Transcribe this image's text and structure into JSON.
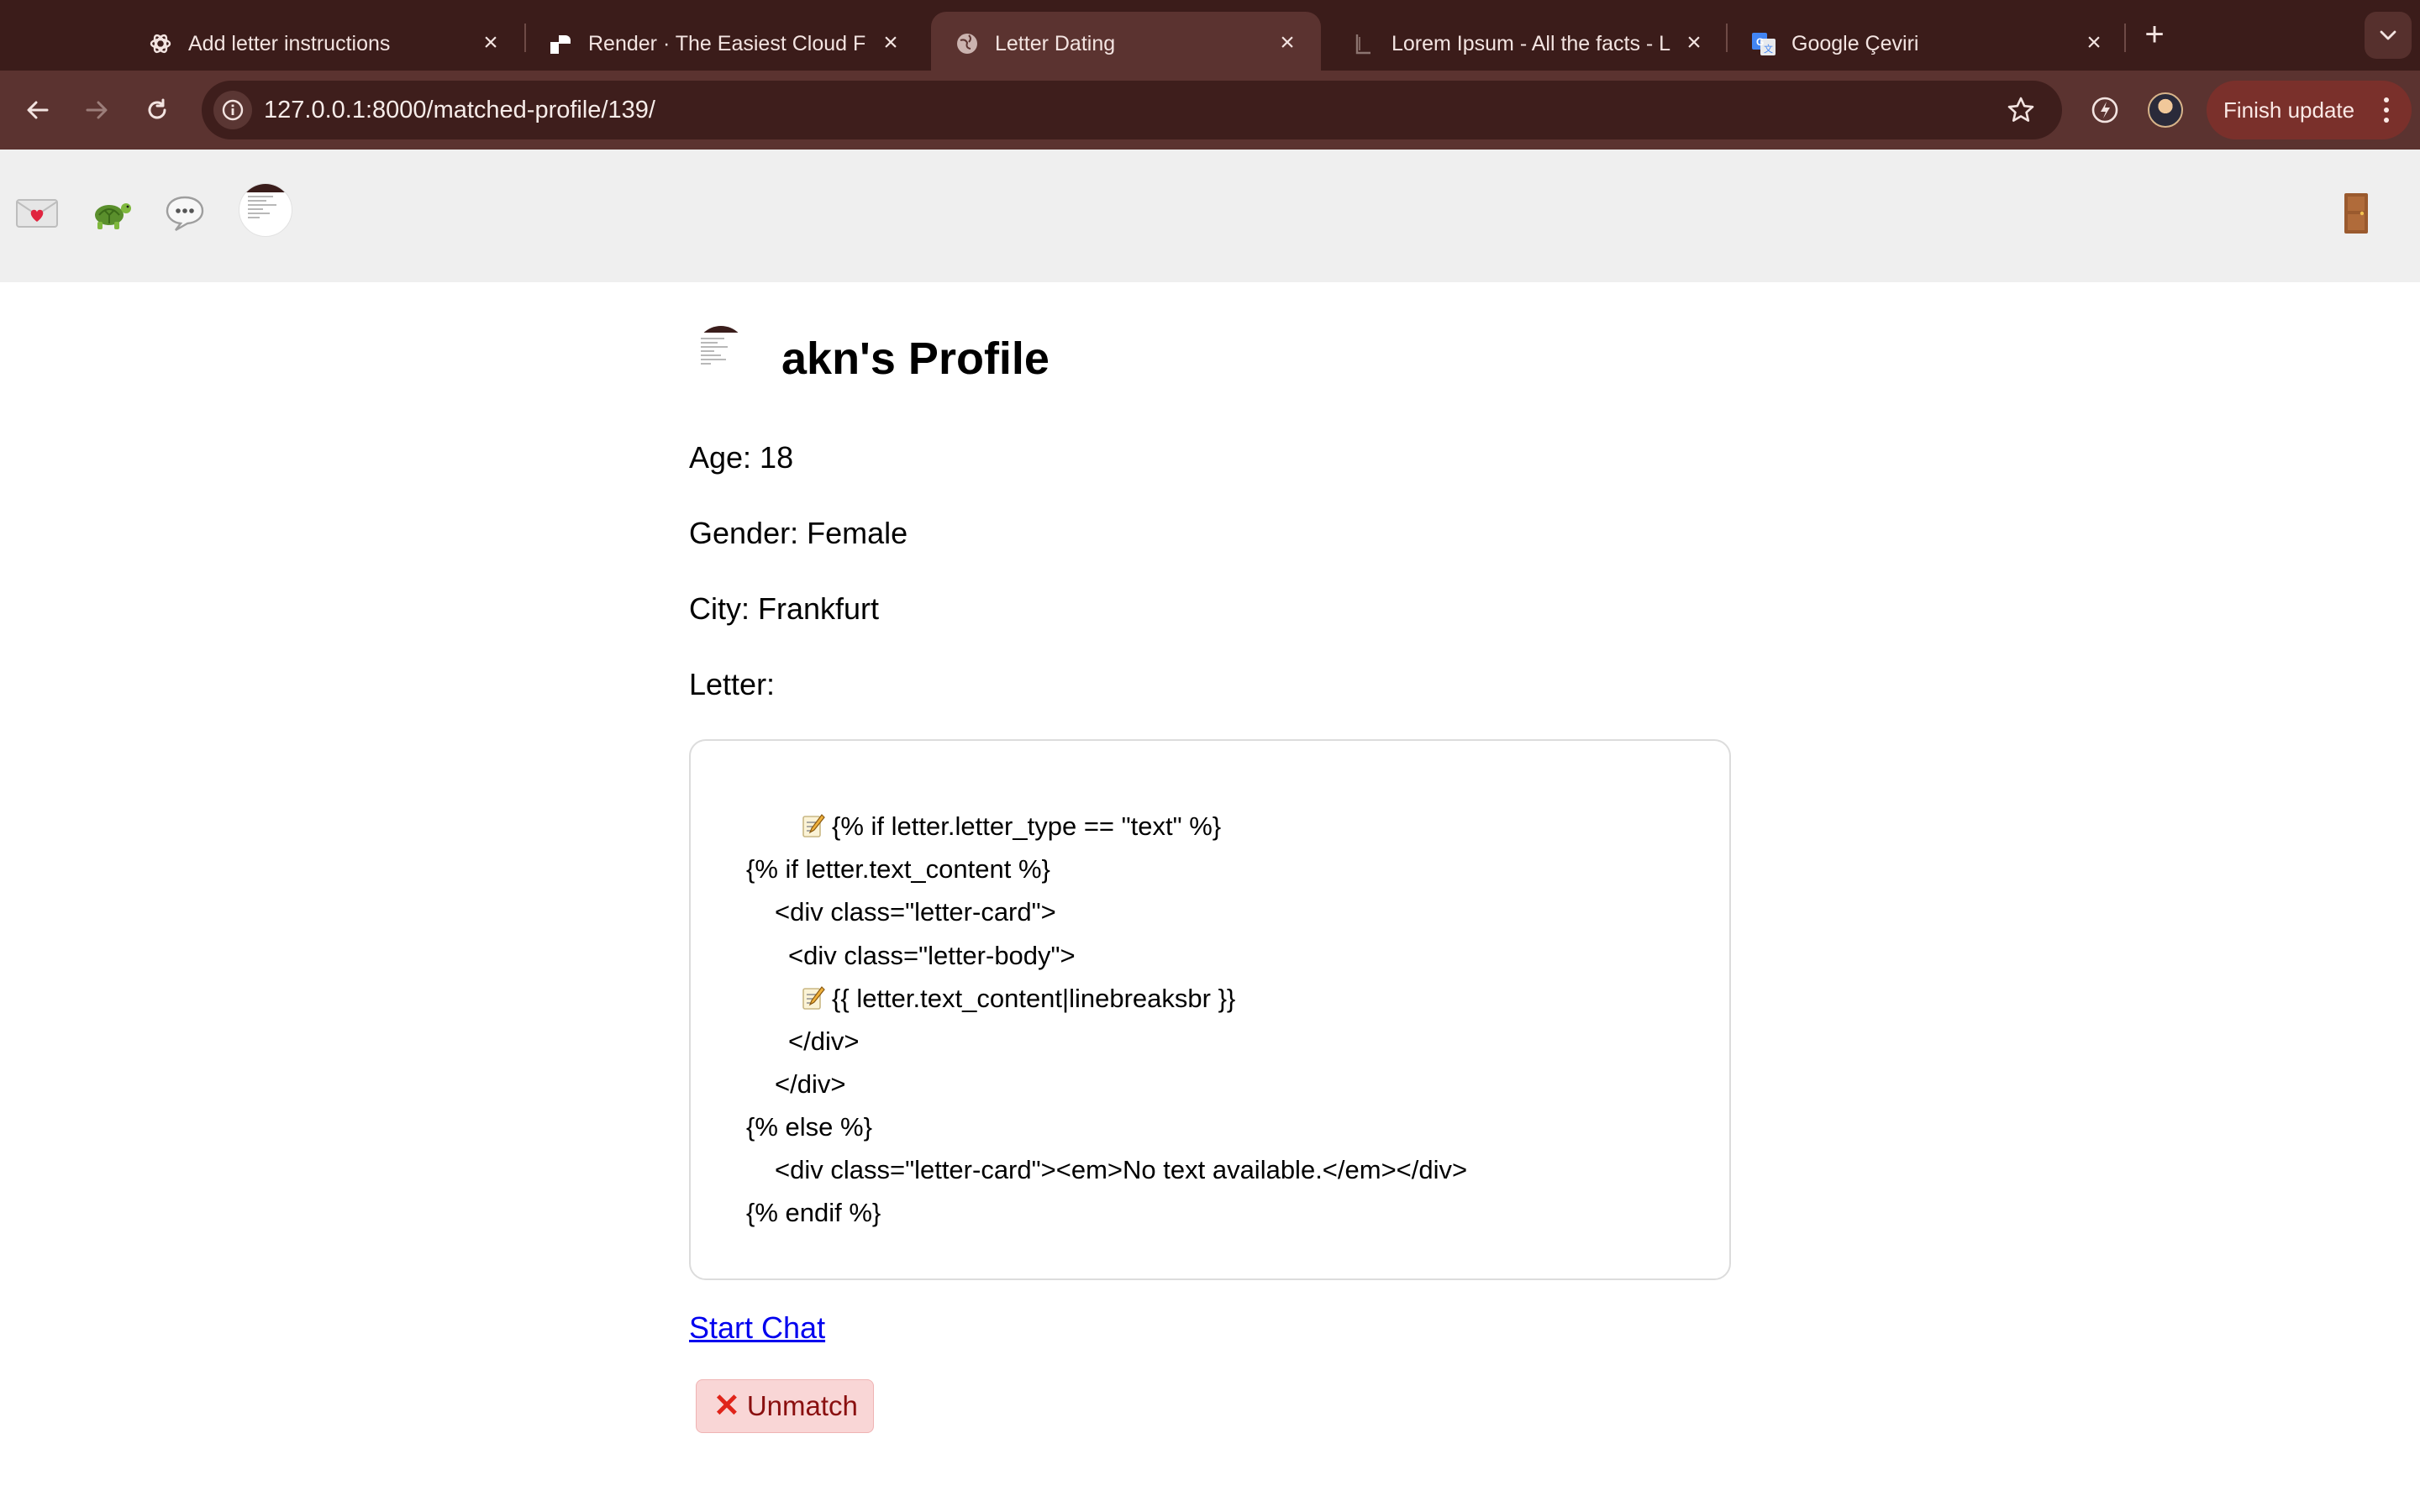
{
  "browser": {
    "tabs": [
      {
        "title": "Add letter instructions",
        "favicon": "openai-icon",
        "active": false
      },
      {
        "title": "Render · The Easiest Cloud Fo",
        "favicon": "render-icon",
        "active": false
      },
      {
        "title": "Letter Dating",
        "favicon": "globe-icon",
        "active": true
      },
      {
        "title": "Lorem Ipsum - All the facts - L",
        "favicon": "lipsum-icon",
        "active": false
      },
      {
        "title": "Google Çeviri",
        "favicon": "google-translate-icon",
        "active": false
      }
    ],
    "new_tab_symbol": "+",
    "url": "127.0.0.1:8000/matched-profile/139/",
    "finish_update_label": "Finish update"
  },
  "app_nav": {
    "icons": [
      "love-letter-icon",
      "turtle-icon",
      "speech-bubble-icon",
      "profile-avatar-icon"
    ],
    "logout_icon": "door-icon"
  },
  "profile": {
    "title": "akn's Profile",
    "age": "Age: 18",
    "gender": "Gender: Female",
    "city": "City: Frankfurt",
    "letter_label": "Letter:",
    "letter_lines": [
      "{% if letter.letter_type == \"text\" %}",
      "{% if letter.text_content %}",
      "<div class=\"letter-card\">",
      "<div class=\"letter-body\">",
      "{{ letter.text_content|linebreaksbr }}",
      "</div>",
      "</div>",
      "{% else %}",
      "<div class=\"letter-card\"><em>No text available.</em></div>",
      "{% endif %}"
    ]
  },
  "actions": {
    "start_chat": "Start Chat",
    "unmatch": "Unmatch",
    "unmatch_icon": "cross-mark-icon"
  },
  "colors": {
    "tabstrip_bg": "#3b1c1a",
    "toolbar_bg": "#5b3330",
    "finish_update_bg": "#7a302b",
    "link": "#0000ee",
    "unmatch_bg": "#f9d6d6"
  }
}
